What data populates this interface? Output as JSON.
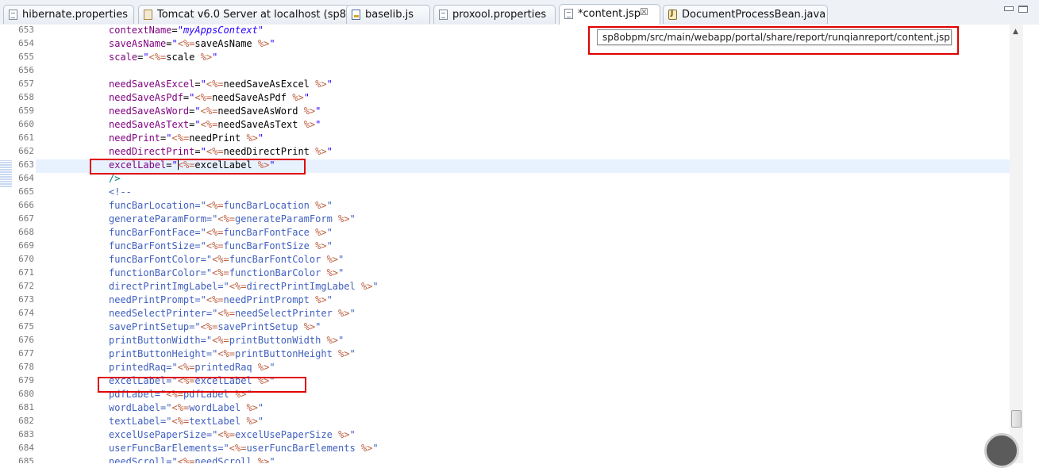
{
  "tabs": [
    {
      "label": "hibernate.properties",
      "icon": "properties-file-icon"
    },
    {
      "label": "Tomcat v6.0 Server at localhost (sp8)",
      "icon": "tomcat-server-icon"
    },
    {
      "label": "baselib.js",
      "icon": "js-file-icon"
    },
    {
      "label": "proxool.properties",
      "icon": "properties-file-icon"
    },
    {
      "label": "*content.jsp",
      "icon": "jsp-file-icon",
      "active": true,
      "close": "☒"
    },
    {
      "label": "DocumentProcessBean.java",
      "icon": "java-file-icon"
    }
  ],
  "window_controls": {
    "minimize": "minimize-icon",
    "maximize": "maximize-icon"
  },
  "tooltip": {
    "text": "sp8obpm/src/main/webapp/portal/share/report/runqianreport/content.jsp"
  },
  "editor": {
    "line_numbers": [
      "653",
      "654",
      "655",
      "656",
      "657",
      "658",
      "659",
      "660",
      "661",
      "662",
      "663",
      "664",
      "665",
      "666",
      "667",
      "668",
      "669",
      "670",
      "671",
      "672",
      "673",
      "674",
      "675",
      "676",
      "677",
      "678",
      "679",
      "680",
      "681",
      "682",
      "683",
      "684",
      "685"
    ],
    "lines": [
      {
        "attr": "contextName",
        "value": "myAppsContext",
        "italic": true
      },
      {
        "attr": "saveAsName",
        "value": "saveAsName"
      },
      {
        "attr": "scale",
        "value": "scale"
      },
      {
        "attr": "",
        "value": ""
      },
      {
        "attr": "needSaveAsExcel",
        "value": "needSaveAsExcel"
      },
      {
        "attr": "needSaveAsPdf",
        "value": "needSaveAsPdf"
      },
      {
        "attr": "needSaveAsWord",
        "value": "needSaveAsWord"
      },
      {
        "attr": "needSaveAsText",
        "value": "needSaveAsText"
      },
      {
        "attr": "needPrint",
        "value": "needPrint"
      },
      {
        "attr": "needDirectPrint",
        "value": "needDirectPrint"
      },
      {
        "attr": "excelLabel",
        "value": "excelLabel",
        "caret": true
      },
      {
        "tag": "/>"
      },
      {
        "tag": "<!--"
      },
      {
        "attr": "funcBarLocation",
        "value": "funcBarLocation",
        "comment": true
      },
      {
        "attr": "generateParamForm",
        "value": "generateParamForm",
        "comment": true
      },
      {
        "attr": "funcBarFontFace",
        "value": "funcBarFontFace",
        "comment": true
      },
      {
        "attr": "funcBarFontSize",
        "value": "funcBarFontSize",
        "comment": true
      },
      {
        "attr": "funcBarFontColor",
        "value": "funcBarFontColor",
        "comment": true
      },
      {
        "attr": "functionBarColor",
        "value": "functionBarColor",
        "comment": true
      },
      {
        "attr": "directPrintImgLabel",
        "value": "directPrintImgLabel",
        "comment": true
      },
      {
        "attr": "needPrintPrompt",
        "value": "needPrintPrompt",
        "comment": true
      },
      {
        "attr": "needSelectPrinter",
        "value": "needSelectPrinter",
        "comment": true
      },
      {
        "attr": "savePrintSetup",
        "value": "savePrintSetup",
        "comment": true
      },
      {
        "attr": "printButtonWidth",
        "value": "printButtonWidth",
        "comment": true
      },
      {
        "attr": "printButtonHeight",
        "value": "printButtonHeight",
        "comment": true
      },
      {
        "attr": "printedRaq",
        "value": "printedRaq",
        "comment": true
      },
      {
        "attr": "excelLabel",
        "value": "excelLabel",
        "comment": true
      },
      {
        "attr": "pdfLabel",
        "value": "pdfLabel",
        "comment": true
      },
      {
        "attr": "wordLabel",
        "value": "wordLabel",
        "comment": true
      },
      {
        "attr": "textLabel",
        "value": "textLabel",
        "comment": true
      },
      {
        "attr": "excelUsePaperSize",
        "value": "excelUsePaperSize",
        "comment": true
      },
      {
        "attr": "userFuncBarElements",
        "value": "userFuncBarElements",
        "comment": true
      },
      {
        "attr": "needScroll",
        "value": "needScroll",
        "comment": true
      }
    ]
  },
  "scrollbar": {
    "position_fraction": 0.92,
    "up_arrow": "▲"
  },
  "colors": {
    "attribute": "#7f007f",
    "string": "#2a00ff",
    "jsp_tag": "#bf5f3f",
    "comment": "#3f5fbf",
    "highlight_box": "#e00000",
    "current_line": "#e8f2fe"
  }
}
